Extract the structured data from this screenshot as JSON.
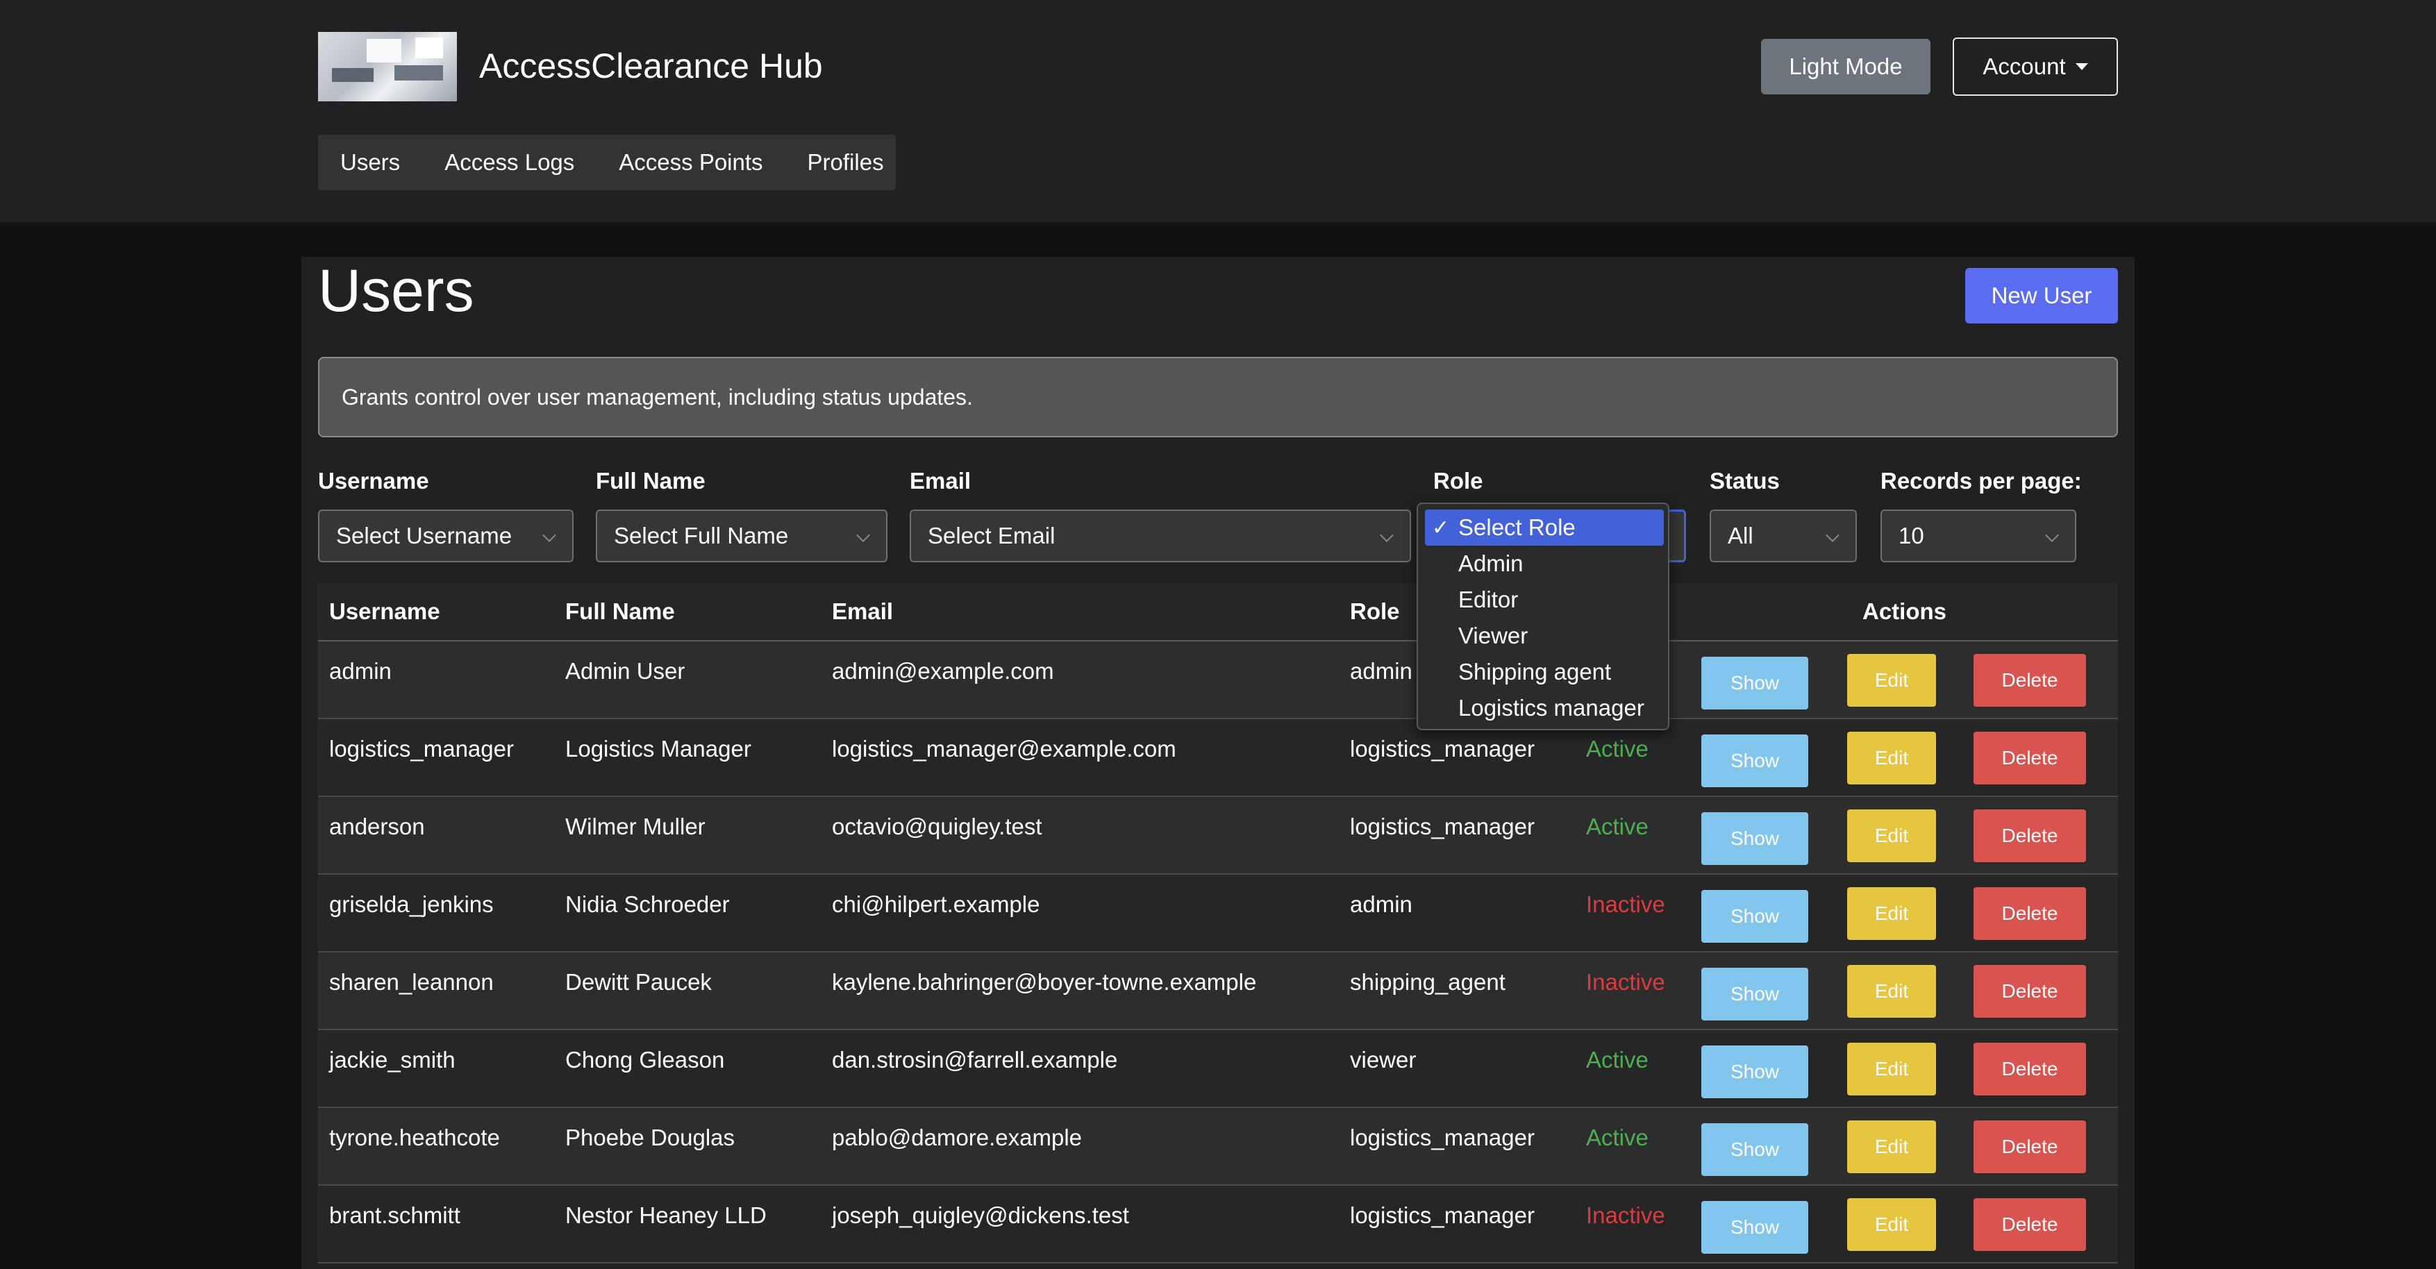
{
  "brand": {
    "title": "AccessClearance Hub",
    "image_alt": "office-photo"
  },
  "header": {
    "light_mode_label": "Light Mode",
    "account_label": "Account"
  },
  "nav": {
    "items": [
      "Users",
      "Access Logs",
      "Access Points",
      "Profiles"
    ]
  },
  "page": {
    "title": "Users",
    "new_button": "New User",
    "alert_text": "Grants control over user management, including status updates."
  },
  "filters": {
    "username": {
      "label": "Username",
      "value": "Select Username"
    },
    "full_name": {
      "label": "Full Name",
      "value": "Select Full Name"
    },
    "email": {
      "label": "Email",
      "value": "Select Email"
    },
    "role": {
      "label": "Role",
      "value": "Select Role",
      "options": [
        "Select Role",
        "Admin",
        "Editor",
        "Viewer",
        "Shipping agent",
        "Logistics manager"
      ]
    },
    "status": {
      "label": "Status",
      "value": "All"
    },
    "per_page": {
      "label": "Records per page:",
      "value": "10"
    }
  },
  "table": {
    "headers": [
      "Username",
      "Full Name",
      "Email",
      "Role",
      "Actions"
    ],
    "action_labels": {
      "show": "Show",
      "edit": "Edit",
      "delete": "Delete"
    },
    "rows": [
      {
        "username": "admin",
        "full_name": "Admin User",
        "email": "admin@example.com",
        "role": "admin",
        "status": ""
      },
      {
        "username": "logistics_manager",
        "full_name": "Logistics Manager",
        "email": "logistics_manager@example.com",
        "role": "logistics_manager",
        "status": "Active"
      },
      {
        "username": "anderson",
        "full_name": "Wilmer Muller",
        "email": "octavio@quigley.test",
        "role": "logistics_manager",
        "status": "Active"
      },
      {
        "username": "griselda_jenkins",
        "full_name": "Nidia Schroeder",
        "email": "chi@hilpert.example",
        "role": "admin",
        "status": "Inactive"
      },
      {
        "username": "sharen_leannon",
        "full_name": "Dewitt Paucek",
        "email": "kaylene.bahringer@boyer-towne.example",
        "role": "shipping_agent",
        "status": "Inactive"
      },
      {
        "username": "jackie_smith",
        "full_name": "Chong Gleason",
        "email": "dan.strosin@farrell.example",
        "role": "viewer",
        "status": "Active"
      },
      {
        "username": "tyrone.heathcote",
        "full_name": "Phoebe Douglas",
        "email": "pablo@damore.example",
        "role": "logistics_manager",
        "status": "Active"
      },
      {
        "username": "brant.schmitt",
        "full_name": "Nestor Heaney LLD",
        "email": "joseph_quigley@dickens.test",
        "role": "logistics_manager",
        "status": "Inactive"
      }
    ]
  },
  "colors": {
    "primary": "#5a6cf0",
    "show": "#82c6ee",
    "edit": "#e6c63f",
    "delete": "#d9534f",
    "active": "#4caf50",
    "inactive": "#e0393e"
  }
}
